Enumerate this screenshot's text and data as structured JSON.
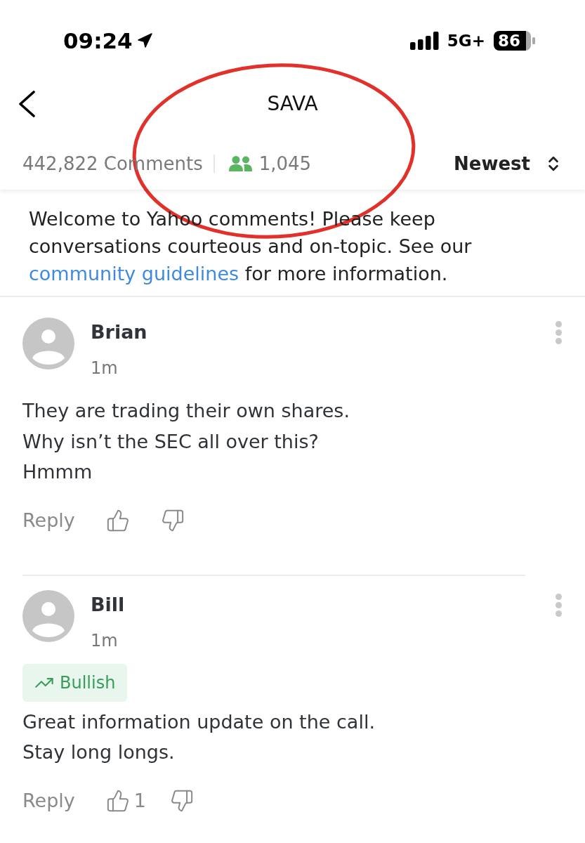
{
  "status_bar": {
    "time": "09:24",
    "network": "5G+",
    "battery": "86"
  },
  "header": {
    "title": "SAVA",
    "comment_count": "442,822 Comments",
    "participants": "1,045",
    "sort": "Newest"
  },
  "notice": {
    "text": "Welcome to Yahoo comments! Please keep conversations courteous and on-topic. See our",
    "link": "community guidelines",
    "after_link": "for more information."
  },
  "comments": [
    {
      "author": "Brian",
      "time": "1m",
      "body": [
        "They are trading their own shares.",
        "Why isn’t the SEC all over this?",
        "Hmmm"
      ],
      "reply": "Reply"
    },
    {
      "author": "Bill",
      "time": "1m",
      "sentiment": {
        "kind": "bullish",
        "label": "Bullish"
      },
      "body": [
        "Great information update on the call.",
        "Stay long longs."
      ],
      "reply": "Reply",
      "likes": "1"
    }
  ],
  "annotations": [
    {
      "kind": "ellipse"
    }
  ]
}
